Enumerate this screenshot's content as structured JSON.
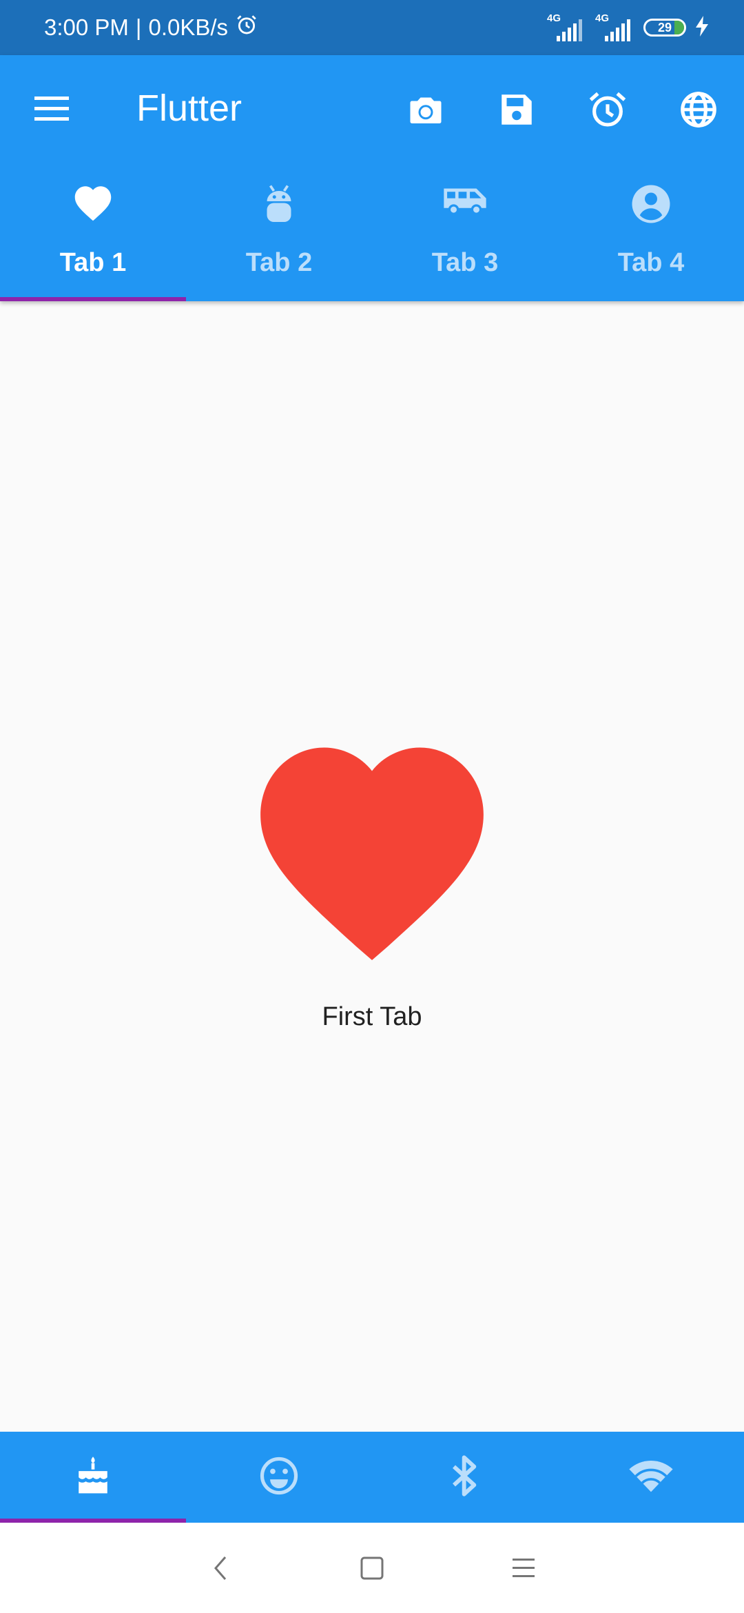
{
  "status_bar": {
    "time": "3:00 PM",
    "separator": "|",
    "speed": "0.0KB/s",
    "signals": [
      {
        "net": "4G"
      },
      {
        "net": "4G"
      }
    ],
    "battery": "29",
    "icons": [
      "alarm-icon",
      "signal-icon",
      "battery-icon",
      "charging-icon"
    ]
  },
  "app_bar": {
    "title": "Flutter",
    "actions": [
      "camera-icon",
      "save-icon",
      "alarm-icon",
      "globe-icon"
    ]
  },
  "tabs": [
    {
      "label": "Tab 1",
      "icon": "heart-icon",
      "active": true
    },
    {
      "label": "Tab 2",
      "icon": "android-icon",
      "active": false
    },
    {
      "label": "Tab 3",
      "icon": "van-icon",
      "active": false
    },
    {
      "label": "Tab 4",
      "icon": "account-icon",
      "active": false
    }
  ],
  "content": {
    "icon": "heart-icon",
    "label": "First Tab"
  },
  "bottom_tabs": [
    {
      "icon": "cake-icon",
      "active": true
    },
    {
      "icon": "smiley-icon",
      "active": false
    },
    {
      "icon": "bluetooth-icon",
      "active": false
    },
    {
      "icon": "wifi-icon",
      "active": false
    }
  ],
  "colors": {
    "status_bar": "#1c6fb9",
    "primary": "#2196f3",
    "indicator": "#8e24aa",
    "heart": "#f44336",
    "inactive_tab": "#bbdefb"
  }
}
